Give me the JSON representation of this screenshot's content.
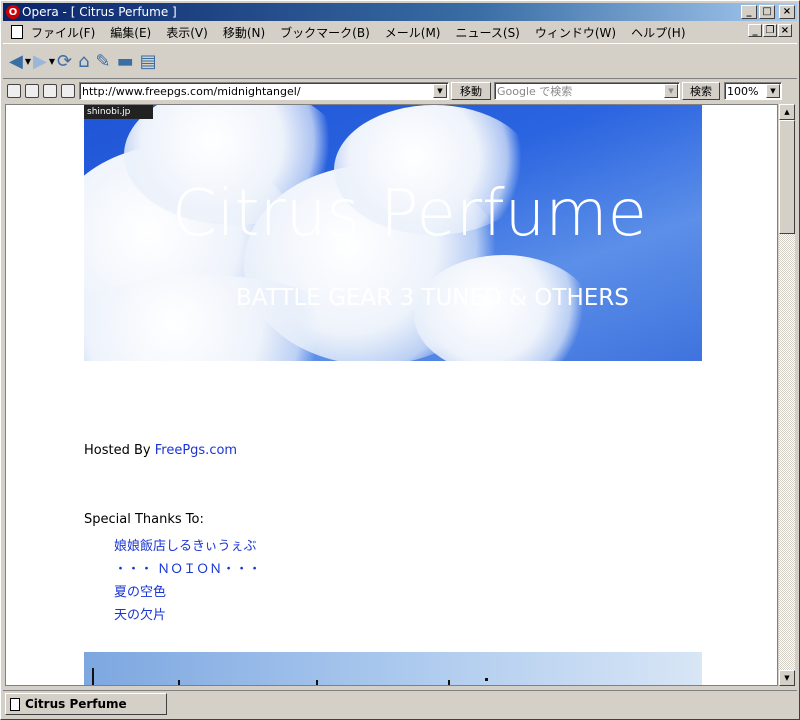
{
  "window": {
    "title": "Opera - [ Citrus Perfume ]",
    "app_icon": "opera-icon"
  },
  "menu": {
    "items": [
      "ファイル(F)",
      "編集(E)",
      "表示(V)",
      "移動(N)",
      "ブックマーク(B)",
      "メール(M)",
      "ニュース(S)",
      "ウィンドウ(W)",
      "ヘルプ(H)"
    ]
  },
  "toolbar": {
    "icons": [
      "back-icon",
      "forward-icon",
      "reload-icon",
      "home-icon",
      "hotlist-icon",
      "print-icon",
      "page-icon"
    ]
  },
  "address": {
    "url": "http://www.freepgs.com/midnightangel/",
    "go_label": "移動",
    "search_placeholder": "Google で検索",
    "search_label": "検索",
    "zoom": "100%"
  },
  "page": {
    "badge": "shinobi.jp",
    "banner_title": "Citrus Perfume",
    "banner_subtitle": "BATTLE GEAR 3 TUNED & OTHERS",
    "hosted_prefix": "Hosted By ",
    "hosted_link": "FreePgs.com",
    "thanks_heading": "Special Thanks To:",
    "thanks_links": [
      "娘娘飯店しるきぃうぇぶ",
      "・・・ ＮＯＩＯＮ・・・",
      "夏の空色",
      "天の欠片"
    ]
  },
  "tabs": [
    {
      "label": "Citrus Perfume"
    }
  ],
  "colors": {
    "title_bar": "#0a246a",
    "link": "#1a35d4",
    "banner_sky": "#2a64e0"
  }
}
